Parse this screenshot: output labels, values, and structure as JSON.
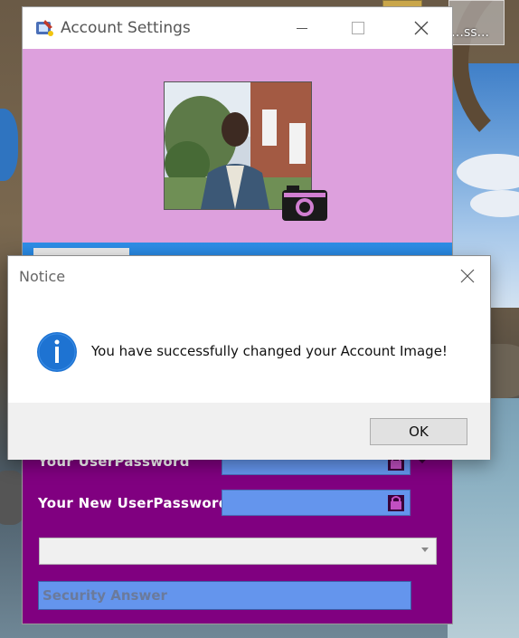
{
  "desktop": {
    "icon_label": "…ss..."
  },
  "window": {
    "title": "Account Settings",
    "labels": {
      "current_password": "Your UserPassword",
      "new_password": "Your New UserPassword"
    },
    "security_question": {
      "selected": ""
    },
    "security_answer": {
      "value": "Security Answer"
    }
  },
  "dialog": {
    "title": "Notice",
    "message": "You have successfully changed your Account Image!",
    "ok_label": "OK"
  },
  "colors": {
    "window_bg": "#800080",
    "profile_panel": "#dda0dd",
    "input_blue": "#6495ed",
    "info_blue": "#1e73d2"
  },
  "icons": {
    "app": "settings-app-icon",
    "camera": "camera-icon",
    "lock": "lock-icon",
    "info": "info-icon",
    "close": "close-icon",
    "minimize": "minimize-icon",
    "maximize": "maximize-icon"
  }
}
